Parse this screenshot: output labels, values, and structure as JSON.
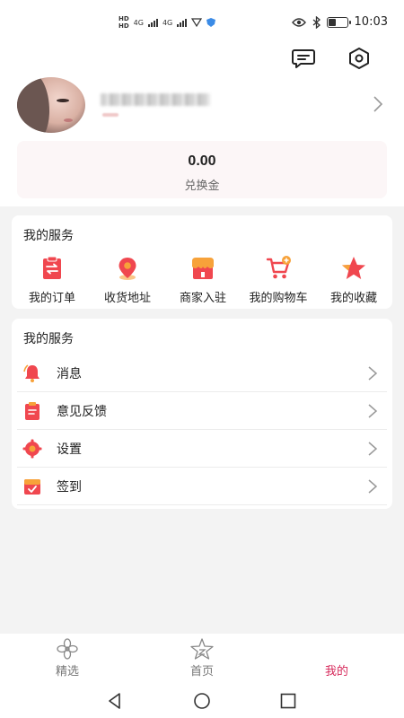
{
  "status_bar": {
    "network_left": "HD",
    "signal1": "4G",
    "signal2": "4G",
    "time": "10:03"
  },
  "profile": {
    "chevron_icon": "chevron-right-icon"
  },
  "points": {
    "value": "0.00",
    "label": "兑换金"
  },
  "services": {
    "title": "我的服务",
    "items": [
      {
        "label": "我的订单",
        "icon": "order-icon"
      },
      {
        "label": "收货地址",
        "icon": "location-pin-icon"
      },
      {
        "label": "商家入驻",
        "icon": "shop-icon"
      },
      {
        "label": "我的购物车",
        "icon": "cart-icon"
      },
      {
        "label": "我的收藏",
        "icon": "star-icon"
      }
    ]
  },
  "menu": {
    "title": "我的服务",
    "items": [
      {
        "label": "消息",
        "icon": "bell-icon"
      },
      {
        "label": "意见反馈",
        "icon": "feedback-icon"
      },
      {
        "label": "设置",
        "icon": "gear-icon"
      },
      {
        "label": "签到",
        "icon": "checkin-icon"
      }
    ]
  },
  "bottom_nav": {
    "items": [
      {
        "label": "精选",
        "active": false
      },
      {
        "label": "首页",
        "active": false
      },
      {
        "label": "我的",
        "active": true
      }
    ]
  },
  "colors": {
    "accent": "#d6285a",
    "icon_red": "#f0474f",
    "icon_orange": "#f7a23a"
  }
}
